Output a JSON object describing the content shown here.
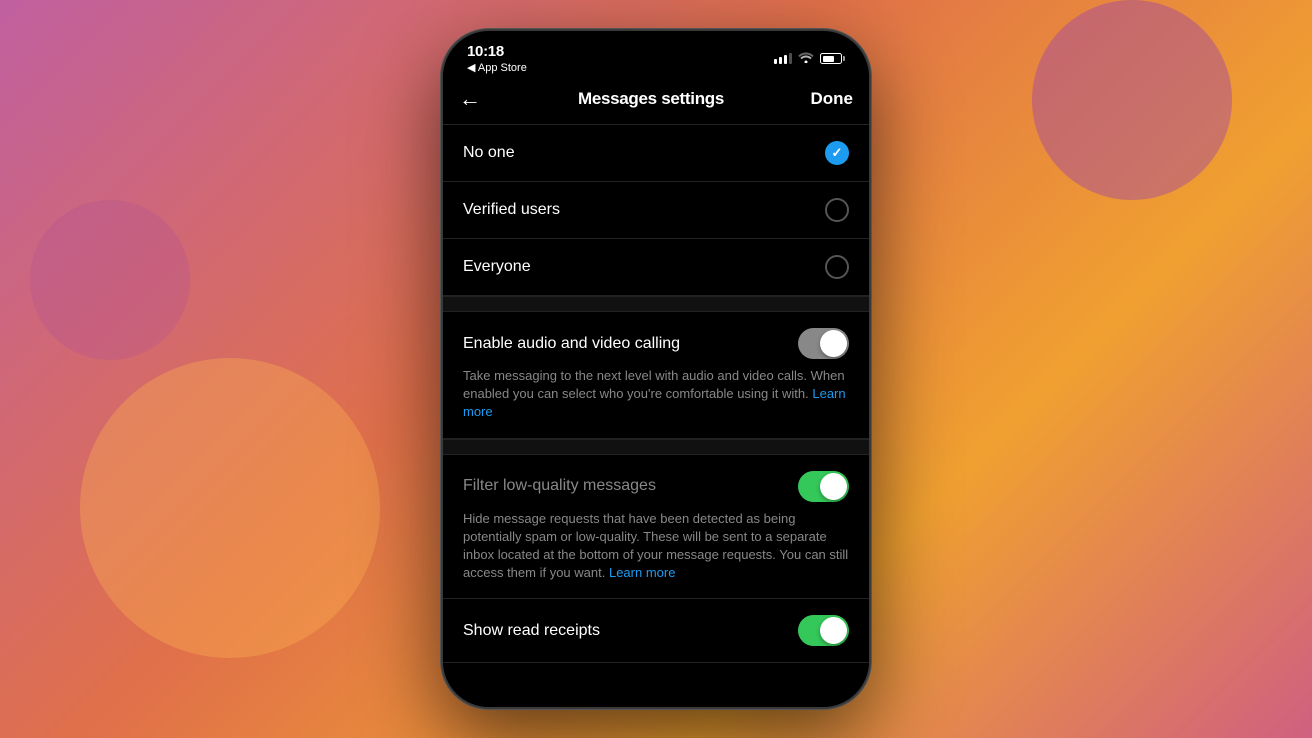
{
  "background": {
    "gradient_desc": "purple-orange-pink gradient"
  },
  "status_bar": {
    "time": "10:18",
    "back_store": "◀ App Store"
  },
  "nav_bar": {
    "title": "Messages settings",
    "done_label": "Done",
    "back_arrow": "←"
  },
  "message_request_section": {
    "no_one": {
      "label": "No one",
      "selected": true
    },
    "verified_users": {
      "label": "Verified users",
      "selected": false
    },
    "everyone": {
      "label": "Everyone",
      "selected": false
    }
  },
  "audio_video_section": {
    "label": "Enable audio and video calling",
    "toggle_state": "off",
    "description": "Take messaging to the next level with audio and video calls. When enabled you can select who you're comfortable using it with.",
    "learn_more_label": "Learn more"
  },
  "filter_section": {
    "label": "Filter low-quality messages",
    "toggle_state": "on",
    "description": "Hide message requests that have been detected as being potentially spam or low-quality. These will be sent to a separate inbox located at the bottom of your message requests. You can still access them if you want.",
    "learn_more_label": "Learn more"
  },
  "read_receipts_section": {
    "label": "Show read receipts",
    "toggle_state": "on"
  }
}
